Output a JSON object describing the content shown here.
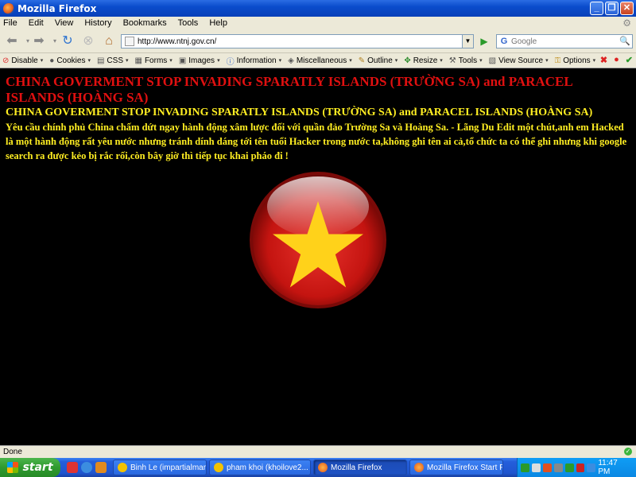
{
  "window": {
    "title": "Mozilla Firefox"
  },
  "menu": [
    "File",
    "Edit",
    "View",
    "History",
    "Bookmarks",
    "Tools",
    "Help"
  ],
  "nav": {
    "url": "http://www.ntnj.gov.cn/",
    "search_placeholder": "Google"
  },
  "devbar": [
    "Disable",
    "Cookies",
    "CSS",
    "Forms",
    "Images",
    "Information",
    "Miscellaneous",
    "Outline",
    "Resize",
    "Tools",
    "View Source",
    "Options"
  ],
  "page": {
    "heading": "CHINA GOVERMENT STOP INVADING SPARATLY ISLANDS (TRƯỜNG SA) and PARACEL ISLANDS (HOÀNG SA)",
    "subheading": "CHINA GOVERMENT STOP INVADING SPARATLY ISLANDS (TRƯỜNG SA) and PARACEL ISLANDS (HOÀNG SA)",
    "body": "Yêu cầu chính phủ China chấm dứt ngay hành động xâm lược đối với quần đảo Trường Sa và Hoàng Sa. - Lãng Du Edit một chút,anh em Hacked là một hành động rất yêu nước nhưng tránh dính dáng tới tên tuổi Hacker trong nước ta,không ghi tên ai cả,tổ chức ta có thể ghi nhưng khi google search ra được kẻo bị rắc rối,còn bây giờ thì tiếp tục khai pháo đi !"
  },
  "status": {
    "text": "Done"
  },
  "taskbar": {
    "start_label": "start",
    "tasks": [
      {
        "label": "Binh Le (impartialman..."
      },
      {
        "label": "pham khoi (khoilove2..."
      },
      {
        "label": "Mozilla Firefox"
      },
      {
        "label": "Mozilla Firefox Start P..."
      }
    ],
    "clock": "11:47 PM"
  },
  "colors": {
    "heading": "#e01010",
    "text": "#ffee22",
    "flag_red": "#d8201e",
    "star": "#ffd21a"
  }
}
